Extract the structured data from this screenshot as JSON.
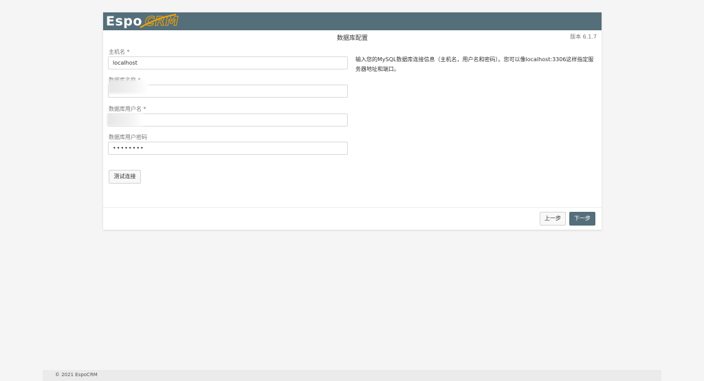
{
  "header": {
    "logo_text_left": "Espo",
    "logo_text_right": "CRM",
    "brand_color": "#546e7a",
    "accent_color": "#f0a30a"
  },
  "page": {
    "title": "数据库配置",
    "version": "版本 6.1.7"
  },
  "form": {
    "host_label": "主机名 *",
    "host_value": "localhost",
    "dbname_label": "数据库名称 *",
    "dbname_value": "",
    "user_label": "数据库用户名 *",
    "user_value": "",
    "password_label": "数据库用户密码",
    "password_value": "••••••••",
    "test_button": "测试连接"
  },
  "info": {
    "text": "输入您的MySQL数据库连接信息（主机名，用户名和密码）。您可以像localhost:3306这样指定服务器地址和端口。"
  },
  "nav": {
    "back_button": "上一步",
    "next_button": "下一步"
  },
  "footer": {
    "copyright": "© 2021 EspoCRM"
  }
}
